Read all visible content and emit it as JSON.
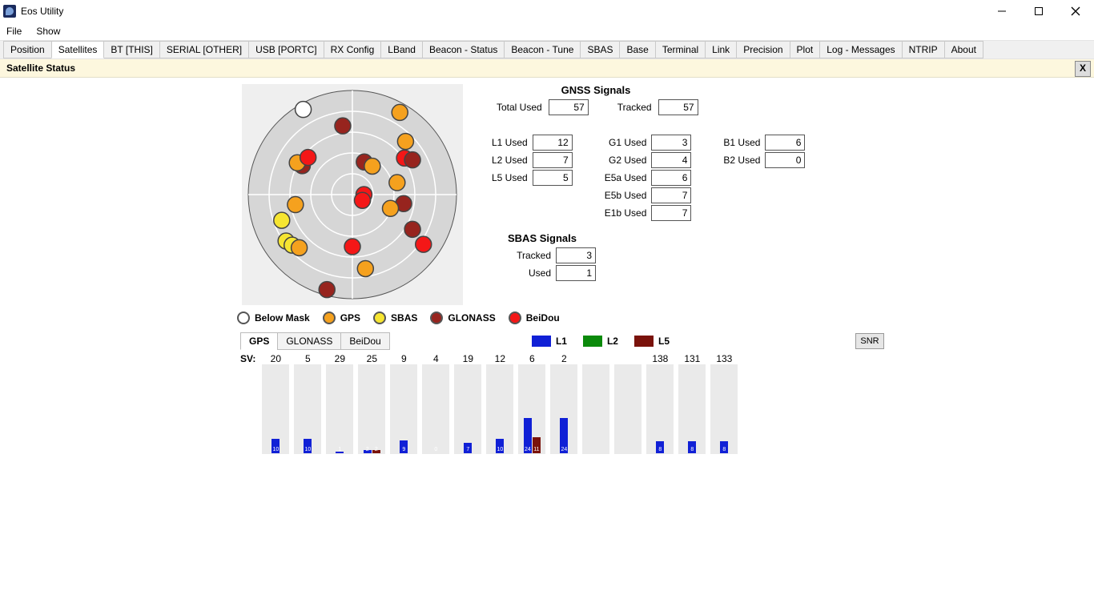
{
  "window": {
    "title": "Eos Utility"
  },
  "menu": {
    "items": [
      "File",
      "Show"
    ]
  },
  "tabs": [
    "Position",
    "Satellites",
    "BT [THIS]",
    "SERIAL [OTHER]",
    "USB [PORTC]",
    "RX Config",
    "LBand",
    "Beacon - Status",
    "Beacon - Tune",
    "SBAS",
    "Base",
    "Terminal",
    "Link",
    "Precision",
    "Plot",
    "Log - Messages",
    "NTRIP",
    "About"
  ],
  "active_tab": "Satellites",
  "panel": {
    "title": "Satellite Status",
    "close_glyph": "X"
  },
  "legend": {
    "items": [
      {
        "label": "Below Mask",
        "fill": "#ffffff"
      },
      {
        "label": "GPS",
        "fill": "#f5a11e"
      },
      {
        "label": "SBAS",
        "fill": "#f6e531"
      },
      {
        "label": "GLONASS",
        "fill": "#97241e"
      },
      {
        "label": "BeiDou",
        "fill": "#f41717"
      }
    ]
  },
  "skyplot": {
    "rings": 5,
    "points": [
      {
        "az": 330,
        "el": 5,
        "c": "#ffffff"
      },
      {
        "az": 352,
        "el": 30,
        "c": "#97241e"
      },
      {
        "az": 30,
        "el": 8,
        "c": "#f5a11e"
      },
      {
        "az": 45,
        "el": 25,
        "c": "#f5a11e"
      },
      {
        "az": 55,
        "el": 35,
        "c": "#f41717"
      },
      {
        "az": 60,
        "el": 30,
        "c": "#97241e"
      },
      {
        "az": 300,
        "el": 40,
        "c": "#97241e"
      },
      {
        "az": 300,
        "el": 35,
        "c": "#f5a11e"
      },
      {
        "az": 310,
        "el": 40,
        "c": "#f41717"
      },
      {
        "az": 75,
        "el": 50,
        "c": "#f5a11e"
      },
      {
        "az": 20,
        "el": 60,
        "c": "#97241e"
      },
      {
        "az": 35,
        "el": 60,
        "c": "#f5a11e"
      },
      {
        "az": 90,
        "el": 80,
        "c": "#f41717"
      },
      {
        "az": 120,
        "el": 80,
        "c": "#f41717"
      },
      {
        "az": 100,
        "el": 45,
        "c": "#97241e"
      },
      {
        "az": 120,
        "el": 30,
        "c": "#97241e"
      },
      {
        "az": 110,
        "el": 55,
        "c": "#f5a11e"
      },
      {
        "az": 125,
        "el": 15,
        "c": "#f41717"
      },
      {
        "az": 250,
        "el": 25,
        "c": "#f6e531"
      },
      {
        "az": 235,
        "el": 20,
        "c": "#f6e531"
      },
      {
        "az": 230,
        "el": 22,
        "c": "#f6e531"
      },
      {
        "az": 225,
        "el": 25,
        "c": "#f5a11e"
      },
      {
        "az": 260,
        "el": 40,
        "c": "#f5a11e"
      },
      {
        "az": 170,
        "el": 25,
        "c": "#f5a11e"
      },
      {
        "az": 180,
        "el": 45,
        "c": "#f41717"
      },
      {
        "az": 195,
        "el": 5,
        "c": "#97241e"
      }
    ]
  },
  "gnss": {
    "heading": "GNSS Signals",
    "total_used_label": "Total Used",
    "total_used": 57,
    "tracked_label": "Tracked",
    "tracked": 57,
    "rows1": [
      {
        "label": "L1 Used",
        "val": 12
      },
      {
        "label": "L2 Used",
        "val": 7
      },
      {
        "label": "L5 Used",
        "val": 5
      }
    ],
    "rows2": [
      {
        "label": "G1 Used",
        "val": 3
      },
      {
        "label": "G2 Used",
        "val": 4
      },
      {
        "label": "E5a Used",
        "val": 6
      },
      {
        "label": "E5b Used",
        "val": 7
      },
      {
        "label": "E1b Used",
        "val": 7
      }
    ],
    "rows3": [
      {
        "label": "B1 Used",
        "val": 6
      },
      {
        "label": "B2 Used",
        "val": 0
      }
    ]
  },
  "sbas": {
    "heading": "SBAS Signals",
    "tracked_label": "Tracked",
    "tracked": 3,
    "used_label": "Used",
    "used": 1
  },
  "chart_data": {
    "tabs": [
      "GPS",
      "GLONASS",
      "BeiDou"
    ],
    "active": "GPS",
    "legend": [
      {
        "label": "L1",
        "color": "#1020d6"
      },
      {
        "label": "L2",
        "color": "#0b8a0b"
      },
      {
        "label": "L5",
        "color": "#7a120b"
      }
    ],
    "sv_label": "SV:",
    "snr_label": "SNR",
    "type": "bar",
    "ylim": [
      0,
      60
    ],
    "series_colors": {
      "L1": "#1020d6",
      "L2": "#0b8a0b",
      "L5": "#7a120b"
    },
    "slots": [
      {
        "sv": "20",
        "L1": 10
      },
      {
        "sv": "5",
        "L1": 10
      },
      {
        "sv": "29",
        "L1": 1
      },
      {
        "sv": "25",
        "L1": 2,
        "L5": 2
      },
      {
        "sv": "9",
        "L1": 9
      },
      {
        "sv": "4",
        "L1": 0
      },
      {
        "sv": "19",
        "L1": 7
      },
      {
        "sv": "12",
        "L1": 10
      },
      {
        "sv": "6",
        "L1": 24,
        "L5": 11
      },
      {
        "sv": "2",
        "L1": 24
      },
      {
        "sv": ""
      },
      {
        "sv": ""
      },
      {
        "sv": "138",
        "L1": 8
      },
      {
        "sv": "131",
        "L1": 8
      },
      {
        "sv": "133",
        "L1": 8
      }
    ]
  }
}
